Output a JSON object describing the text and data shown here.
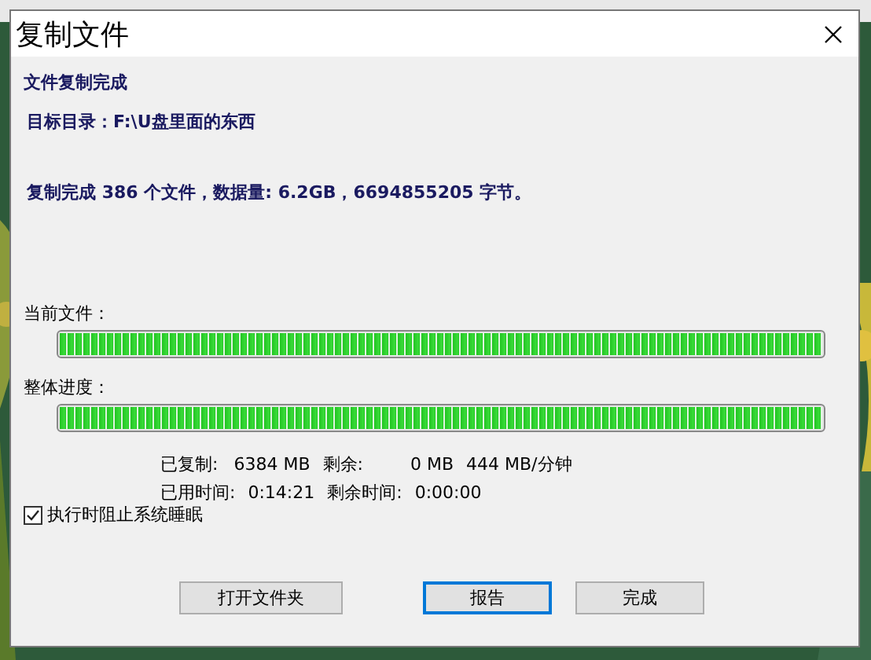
{
  "window": {
    "title": "复制文件"
  },
  "heading": "文件复制完成",
  "target": "目标目录：F:\\U盘里面的东西",
  "summary": "复制完成 386 个文件，数据量: 6.2GB，6694855205 字节。",
  "progress": [
    {
      "label": "当前文件：",
      "level": 1
    },
    {
      "label": "整体进度：",
      "level": 1
    }
  ],
  "stats": [
    [
      "已复制:",
      "6384 MB",
      "剩余:",
      "0 MB",
      "444 MB/分钟"
    ],
    [
      "已用时间:",
      "0:14:21",
      "剩余时间:",
      "0:00:00"
    ]
  ],
  "checkbox": {
    "label": "执行时阻止系统睡眠",
    "checked": true
  },
  "buttons": [
    {
      "label": "打开文件夹",
      "default": false
    },
    {
      "label": "报告",
      "default": true
    },
    {
      "label": "完成",
      "default": false
    }
  ]
}
